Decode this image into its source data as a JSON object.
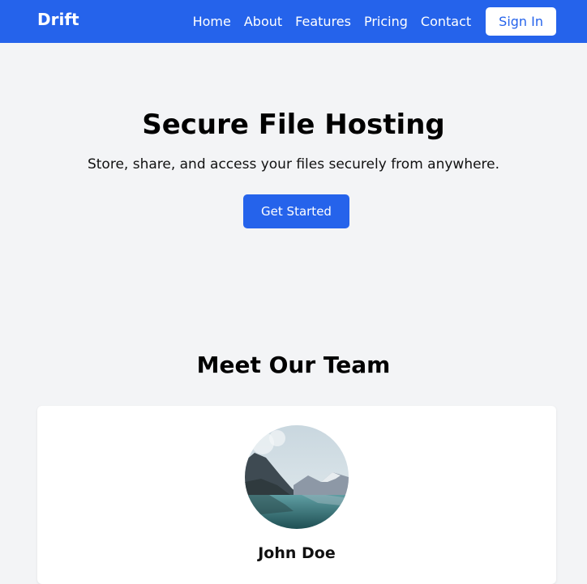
{
  "nav": {
    "brand": "Drift",
    "links": [
      "Home",
      "About",
      "Features",
      "Pricing",
      "Contact"
    ],
    "signin_label": "Sign In"
  },
  "hero": {
    "title": "Secure File Hosting",
    "subtitle": "Store, share, and access your files securely from anywhere.",
    "cta_label": "Get Started"
  },
  "team": {
    "heading": "Meet Our Team",
    "members": [
      {
        "name": "John Doe"
      }
    ]
  },
  "colors": {
    "brand_blue": "#2563eb",
    "page_background": "#f3f4f6",
    "card_background": "#ffffff"
  }
}
